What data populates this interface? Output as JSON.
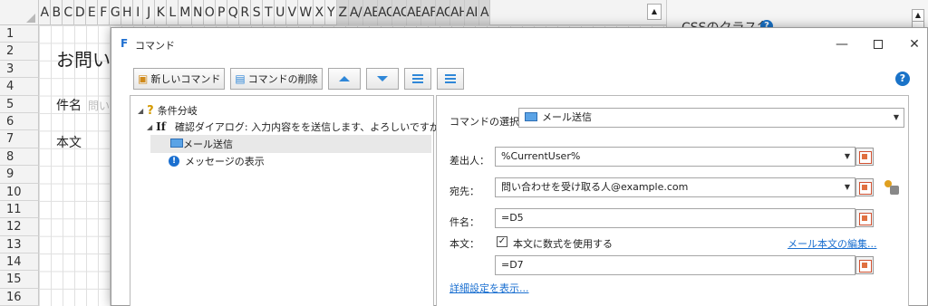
{
  "sheet": {
    "columns": [
      "A",
      "B",
      "C",
      "D",
      "E",
      "F",
      "G",
      "H",
      "I",
      "J",
      "K",
      "L",
      "M",
      "N",
      "O",
      "P",
      "Q",
      "R",
      "S",
      "T",
      "U",
      "V",
      "W",
      "X",
      "Y",
      "Z",
      "AA",
      "AB",
      "AC",
      "AD",
      "AE",
      "AF",
      "AG",
      "AH",
      "AI",
      "A"
    ],
    "column_labels_display": [
      "A",
      "B",
      "C",
      "D",
      "E",
      "F",
      "G",
      "H",
      "I",
      "J",
      "K",
      "L",
      "M",
      "N",
      "O",
      "P",
      "Q",
      "R",
      "S",
      "T",
      "U",
      "V",
      "W",
      "X",
      "Y",
      "Z",
      "A/",
      "AE",
      "AC",
      "AC",
      "AE",
      "AF",
      "AG",
      "AH",
      "AI",
      "A"
    ],
    "rows": [
      "1",
      "2",
      "3",
      "4",
      "5",
      "6",
      "7",
      "8",
      "9",
      "10",
      "11",
      "12",
      "13",
      "14",
      "15",
      "16"
    ],
    "cell_title": "お問い",
    "cell_subject_label": "件名",
    "cell_subject_hint": "問い",
    "cell_body_label": "本文"
  },
  "right_pane": {
    "title": "CSSのクラス名",
    "help": "?"
  },
  "dialog": {
    "app_icon": "F",
    "title": "コマンド",
    "help": "?",
    "toolbar": {
      "new_command": "新しいコマンド",
      "delete_command": "コマンドの削除"
    },
    "tree": {
      "condition_branch": "条件分岐",
      "if_keyword": "If",
      "if_text": "確認ダイアログ: 入力内容をを送信します、よろしいですか？",
      "send_mail": "メール送信",
      "show_message": "メッセージの表示"
    },
    "detail": {
      "command_select_label": "コマンドの選択：",
      "command_select_value": "メール送信",
      "sender_label": "差出人：",
      "sender_value": "%CurrentUser%",
      "to_label": "宛先：",
      "to_value": "問い合わせを受け取る人@example.com",
      "subject_label": "件名：",
      "subject_value": "=D5",
      "body_label": "本文：",
      "body_formula_checkbox": "本文に数式を使用する",
      "body_formula_checked": true,
      "edit_mail_body_link": "メール本文の編集...",
      "body_value": "=D7",
      "advanced_link": "詳細設定を表示..."
    }
  }
}
